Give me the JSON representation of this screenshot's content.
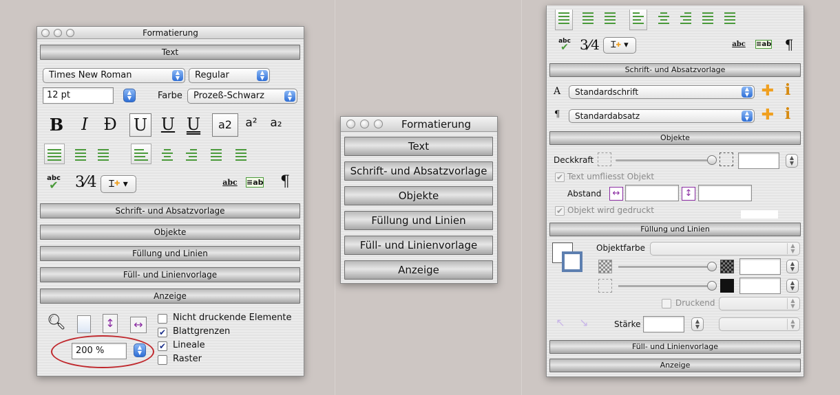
{
  "window1": {
    "title": "Formatierung",
    "text_section": "Text",
    "font_family": "Times New Roman",
    "font_style": "Regular",
    "font_size": "12 pt",
    "color_label": "Farbe",
    "color_value": "Prozeß-Schwarz",
    "styles": [
      "B",
      "I",
      "Đ",
      "U",
      "U",
      "U",
      "a2",
      "a²",
      "a₂"
    ],
    "fraction": "3⁄4",
    "sections": [
      "Schrift- und Absatzvorlage",
      "Objekte",
      "Füllung und Linien",
      "Füll- und Linienvorlage",
      "Anzeige"
    ],
    "zoom_value": "200 %",
    "checkboxes": [
      {
        "label": "Nicht druckende Elemente",
        "checked": false
      },
      {
        "label": "Blattgrenzen",
        "checked": true
      },
      {
        "label": "Lineale",
        "checked": true
      },
      {
        "label": "Raster",
        "checked": false
      }
    ],
    "highlight_color": "#c0282d"
  },
  "window2": {
    "title": "Formatierung",
    "sections": [
      "Text",
      "Schrift- und Absatzvorlage",
      "Objekte",
      "Füllung und Linien",
      "Füll- und Linienvorlage",
      "Anzeige"
    ]
  },
  "window3": {
    "fraction": "3⁄4",
    "section_styles": "Schrift- und Absatzvorlage",
    "char_style_glyph": "A",
    "char_style": "Standardschrift",
    "para_style_glyph": "¶",
    "para_style": "Standardabsatz",
    "section_objects": "Objekte",
    "opacity_label": "Deckkraft",
    "text_flow_label": "Text umfliesst Objekt",
    "distance_label": "Abstand",
    "printed_label": "Objekt wird gedruckt",
    "section_fill": "Füllung und Linien",
    "object_color_label": "Objektfarbe",
    "printing_label": "Druckend",
    "stroke_label": "Stärke",
    "section_fill_style": "Füll- und Linienvorlage",
    "section_view": "Anzeige",
    "accent_green": "#4a9a3a",
    "accent_orange": "#f0a020"
  }
}
